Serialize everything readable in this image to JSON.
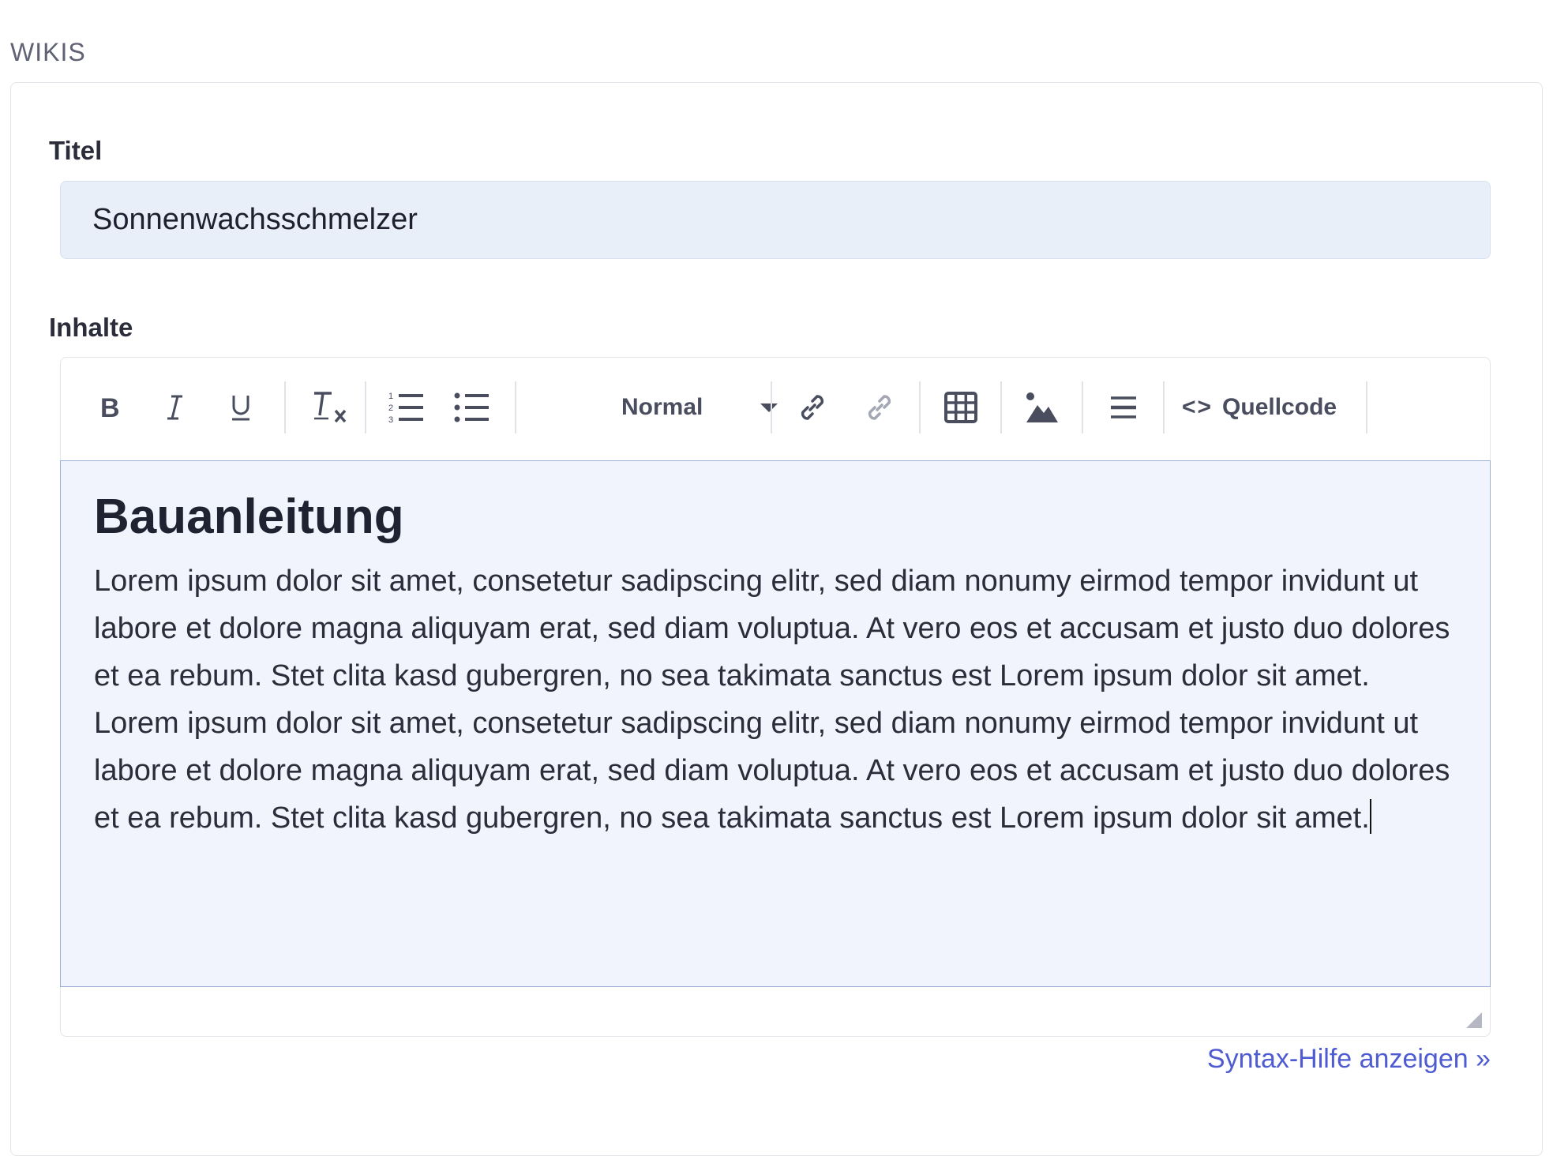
{
  "section": {
    "heading": "WIKIS"
  },
  "form": {
    "title_label": "Titel",
    "title_value": "Sonnenwachsschmelzer",
    "content_label": "Inhalte"
  },
  "toolbar": {
    "bold": "bold-icon",
    "italic": "italic-icon",
    "underline": "underline-icon",
    "clear_format": "clear-format-icon",
    "ordered_list": "ordered-list-icon",
    "unordered_list": "unordered-list-icon",
    "format_value": "Normal",
    "link": "link-icon",
    "unlink": "unlink-icon",
    "table": "table-icon",
    "image": "image-icon",
    "horizontal_rule": "horizontal-rule-icon",
    "source_glyph": "<>",
    "source_label": "Quellcode"
  },
  "editor": {
    "heading": "Bauanleitung",
    "paragraph": "Lorem ipsum dolor sit amet, consetetur sadipscing elitr, sed diam nonumy eirmod tempor invidunt ut labore et dolore magna aliquyam erat, sed diam voluptua. At vero eos et accusam et justo duo dolores et ea rebum. Stet clita kasd gubergren, no sea takimata sanctus est Lorem ipsum dolor sit amet. Lorem ipsum dolor sit amet, consetetur sadipscing elitr, sed diam nonumy eirmod tempor invidunt ut labore et dolore magna aliquyam erat, sed diam voluptua. At vero eos et accusam et justo duo dolores et ea rebum. Stet clita kasd gubergren, no sea takimata sanctus est Lorem ipsum dolor sit amet."
  },
  "footer": {
    "syntax_help": "Syntax-Hilfe anzeigen »"
  },
  "colors": {
    "input_bg": "#e9eff9",
    "editor_bg": "#f1f4fd",
    "link": "#4e5bd1",
    "text": "#2b2d3a"
  }
}
